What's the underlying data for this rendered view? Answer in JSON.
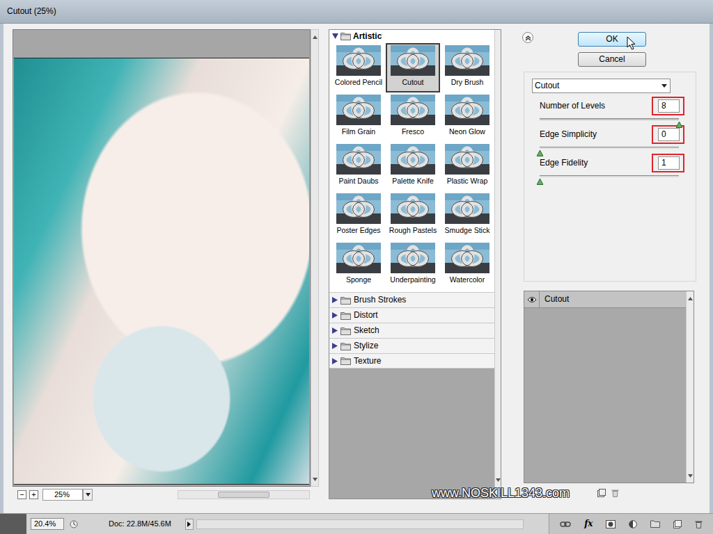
{
  "window": {
    "title": "Cutout (25%)"
  },
  "preview": {
    "zoom": "25%",
    "zoom_out": "−",
    "zoom_in": "+"
  },
  "gallery": {
    "categories": [
      {
        "name": "Artistic",
        "expanded": true,
        "filters": [
          {
            "label": "Colored Pencil",
            "selected": false
          },
          {
            "label": "Cutout",
            "selected": true
          },
          {
            "label": "Dry Brush",
            "selected": false
          },
          {
            "label": "Film Grain",
            "selected": false
          },
          {
            "label": "Fresco",
            "selected": false
          },
          {
            "label": "Neon Glow",
            "selected": false
          },
          {
            "label": "Paint Daubs",
            "selected": false
          },
          {
            "label": "Palette Knife",
            "selected": false
          },
          {
            "label": "Plastic Wrap",
            "selected": false
          },
          {
            "label": "Poster Edges",
            "selected": false
          },
          {
            "label": "Rough Pastels",
            "selected": false
          },
          {
            "label": "Smudge Stick",
            "selected": false
          },
          {
            "label": "Sponge",
            "selected": false
          },
          {
            "label": "Underpainting",
            "selected": false
          },
          {
            "label": "Watercolor",
            "selected": false
          }
        ]
      },
      {
        "name": "Brush Strokes",
        "expanded": false
      },
      {
        "name": "Distort",
        "expanded": false
      },
      {
        "name": "Sketch",
        "expanded": false
      },
      {
        "name": "Stylize",
        "expanded": false
      },
      {
        "name": "Texture",
        "expanded": false
      }
    ]
  },
  "buttons": [
    {
      "label": "OK",
      "focused": true
    },
    {
      "label": "Cancel",
      "focused": false
    }
  ],
  "filter_select": {
    "value": "Cutout"
  },
  "settings": [
    {
      "label": "Number of Levels",
      "value": "8",
      "level": 1,
      "highlighted": true
    },
    {
      "label": "Edge Simplicity",
      "value": "0",
      "level": 0,
      "highlighted": true
    },
    {
      "label": "Edge Fidelity",
      "value": "1",
      "level": 0,
      "highlighted": true
    }
  ],
  "effect_layers": [
    {
      "name": "Cutout",
      "visible": true,
      "selected": true
    }
  ],
  "watermark": "www.NOSKILL1343.com",
  "status_bar": {
    "zoom": "20.4%",
    "doc": "Doc: 22.8M/45.6M",
    "fx": "fx"
  }
}
